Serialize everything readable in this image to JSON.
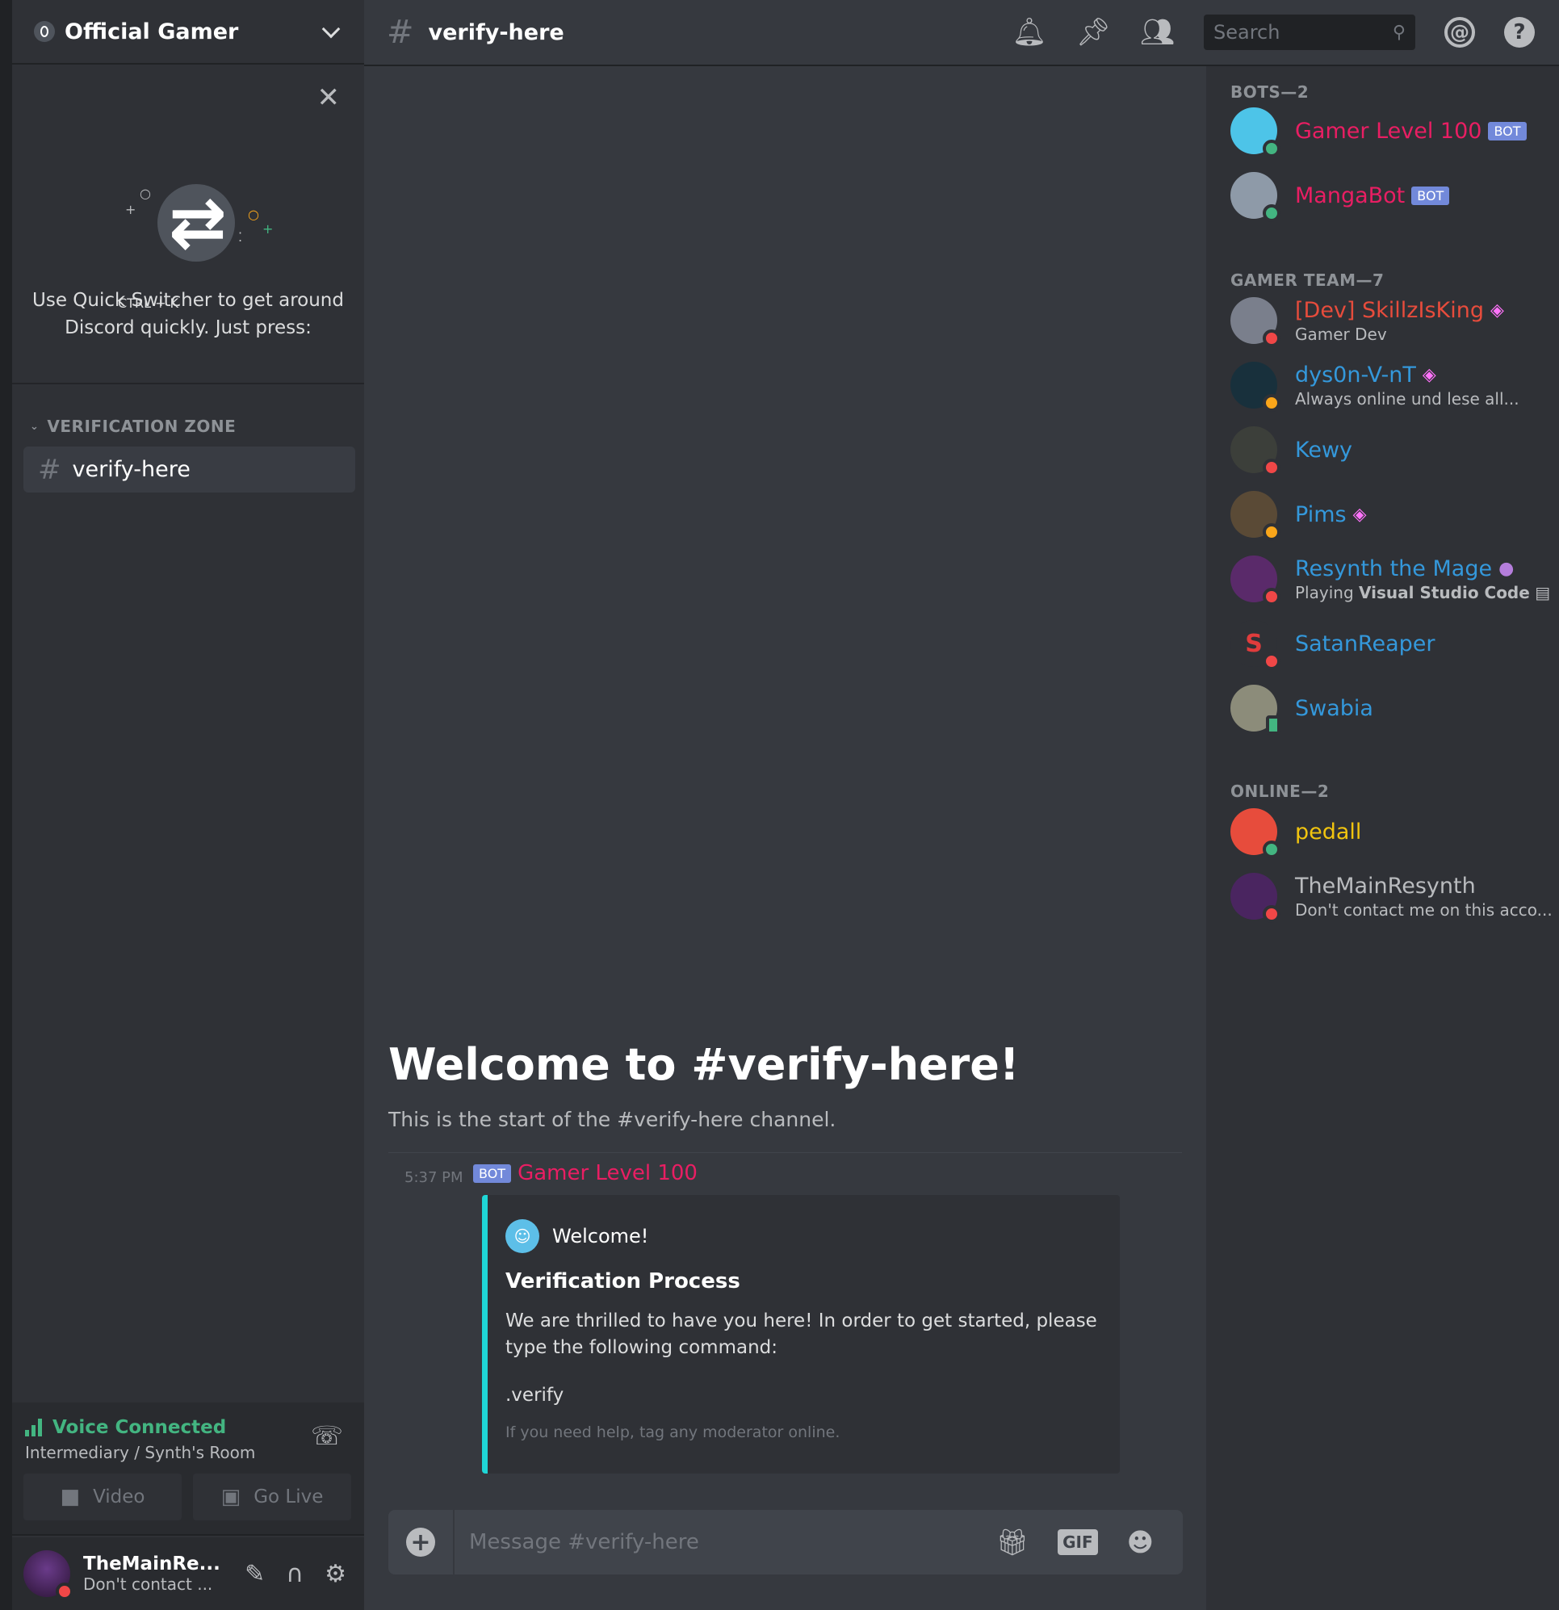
{
  "server": {
    "name": "Official Gamer"
  },
  "quick_switcher": {
    "text": "Use Quick Switcher to get around Discord quickly. Just press:",
    "shortcut": "CTRL + K"
  },
  "channels": {
    "category": "VERIFICATION ZONE",
    "items": [
      {
        "name": "verify-here"
      }
    ]
  },
  "voice": {
    "status": "Voice Connected",
    "room": "Intermediary / Synth's Room",
    "video_label": "Video",
    "golive_label": "Go Live"
  },
  "user": {
    "name": "TheMainRe...",
    "status": "Don't contact ..."
  },
  "header": {
    "channel": "verify-here",
    "search_placeholder": "Search"
  },
  "chat": {
    "welcome_title": "Welcome to #verify-here!",
    "welcome_sub": "This is the start of the #verify-here channel.",
    "message": {
      "time": "5:37 PM",
      "bot_badge": "BOT",
      "author": "Gamer Level 100",
      "embed": {
        "author": "Welcome!",
        "title": "Verification Process",
        "description": "We are thrilled to have you here! In order to get started, please type the following command:",
        "command": ".verify",
        "footer": "If you need help, tag any moderator online."
      }
    },
    "composer_placeholder": "Message #verify-here",
    "gif_label": "GIF"
  },
  "members": {
    "groups": [
      {
        "title": "BOTS—2"
      },
      {
        "title": "GAMER TEAM—7"
      },
      {
        "title": "ONLINE—2"
      }
    ],
    "bots": [
      {
        "name": "Gamer Level 100",
        "badge": "BOT",
        "color": "#e91e63"
      },
      {
        "name": "MangaBot",
        "badge": "BOT",
        "color": "#e91e63"
      }
    ],
    "team": [
      {
        "name": "[Dev] SkillzIsKing",
        "sub": "Gamer Dev",
        "color": "#e74c3c"
      },
      {
        "name": "dys0n-V-nT",
        "sub": "Always online und lese all...",
        "color": "#3498db"
      },
      {
        "name": "Kewy",
        "color": "#3498db"
      },
      {
        "name": "Pims",
        "color": "#3498db"
      },
      {
        "name": "Resynth the Mage",
        "sub_prefix": "Playing",
        "sub_bold": "Visual Studio Code",
        "color": "#3498db"
      },
      {
        "name": "SatanReaper",
        "color": "#3498db"
      },
      {
        "name": "Swabia",
        "color": "#3498db"
      }
    ],
    "online": [
      {
        "name": "pedall",
        "color": "#f1c40f"
      },
      {
        "name": "TheMainResynth",
        "sub": "Don't contact me on this acco...",
        "color": "#b9bbbe"
      }
    ]
  },
  "colors": {
    "blurple": "#7289da",
    "embed_border": "#1fd6d6",
    "online": "#43b581",
    "dnd": "#f04747",
    "idle": "#faa61a"
  }
}
